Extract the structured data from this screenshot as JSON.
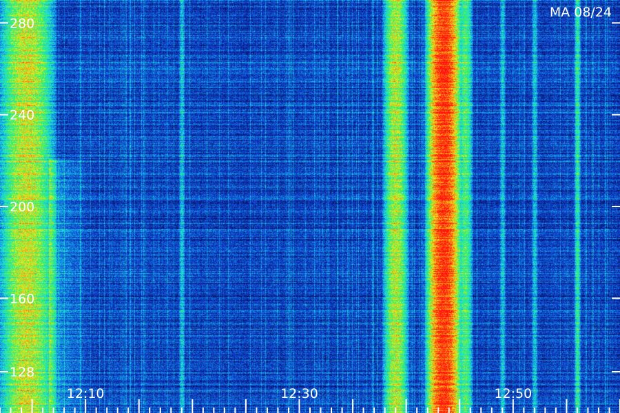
{
  "chart_data": {
    "type": "heatmap",
    "title": "",
    "annotation": "MA 08/24",
    "xlabel": "",
    "ylabel": "",
    "x_tick_labels": [
      "12:10",
      "12:30",
      "12:50"
    ],
    "y_tick_labels": [
      "128",
      "160",
      "200",
      "240",
      "280"
    ],
    "x_range": [
      "12:02",
      "13:00"
    ],
    "y_range": [
      110,
      290
    ],
    "colormap": [
      "#000010",
      "#0a1a7a",
      "#1040d0",
      "#1090e0",
      "#20e0e0",
      "#30f060",
      "#e8f020",
      "#ff8010",
      "#ff1010"
    ],
    "series": [
      {
        "name": "",
        "band": [
          "12:02",
          "12:07"
        ],
        "intensity": 0.72
      },
      {
        "name": "",
        "band": [
          "12:19",
          "12:19"
        ],
        "intensity": 0.45
      },
      {
        "name": "",
        "band": [
          "12:38",
          "12:40"
        ],
        "intensity": 0.7
      },
      {
        "name": "",
        "band": [
          "12:42",
          "12:45"
        ],
        "intensity": 0.95
      },
      {
        "name": "",
        "band": [
          "12:45",
          "12:46"
        ],
        "intensity": 0.6
      },
      {
        "name": "",
        "band": [
          "12:49",
          "12:49"
        ],
        "intensity": 0.45
      },
      {
        "name": "",
        "band": [
          "12:52",
          "12:52"
        ],
        "intensity": 0.45
      },
      {
        "name": "",
        "band": [
          "12:56",
          "12:56"
        ],
        "intensity": 0.55
      }
    ]
  }
}
